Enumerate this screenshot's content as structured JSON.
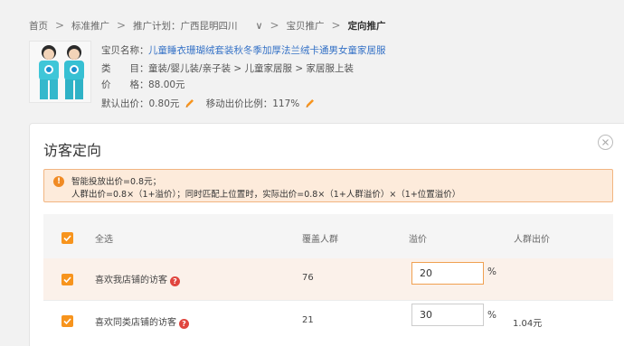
{
  "breadcrumb": {
    "items": [
      "首页",
      "标准推广",
      "推广计划：广西昆明四川",
      "宝贝推广",
      "定向推广"
    ],
    "separator": ">",
    "dropdown_glyph": "∨"
  },
  "product": {
    "name_label": "宝贝名称：",
    "name": "儿童睡衣珊瑚绒套装秋冬季加厚法兰绒卡通男女童家居服",
    "category_label": "类　　目：",
    "category": "童装/婴儿装/亲子装 > 儿童家居服 > 家居服上装",
    "price_label": "价　　格：",
    "price": "88.00元",
    "default_bid_label": "默认出价：",
    "default_bid": "0.80元",
    "mobile_ratio_label": "移动出价比例：",
    "mobile_ratio": "117%"
  },
  "dialog": {
    "title": "访客定向",
    "notice_line1": "智能投放出价=0.8元；",
    "notice_line2": "人群出价=0.8×（1+溢价）；同时匹配上位置时，实际出价=0.8×（1+人群溢价）×（1+位置溢价）"
  },
  "table": {
    "headers": {
      "select_all": "全选",
      "coverage": "覆盖人群",
      "premium": "溢价",
      "crowd_bid": "人群出价"
    },
    "rows": [
      {
        "name": "喜欢我店铺的访客",
        "coverage": "76",
        "premium": "20",
        "unit": "%",
        "crowd_bid": ""
      },
      {
        "name": "喜欢同类店铺的访客",
        "coverage": "21",
        "premium": "30",
        "unit": "%",
        "crowd_bid": "1.04元"
      }
    ]
  },
  "colors": {
    "accent": "#f7941d",
    "link": "#3471c6",
    "notice_bg": "#fdebdb",
    "notice_border": "#f2b581",
    "help": "#e0453e"
  },
  "icons": [
    "chevron-right-icon",
    "chevron-down-icon",
    "pencil-icon",
    "close-icon",
    "warning-icon",
    "checkmark-icon",
    "help-icon"
  ]
}
